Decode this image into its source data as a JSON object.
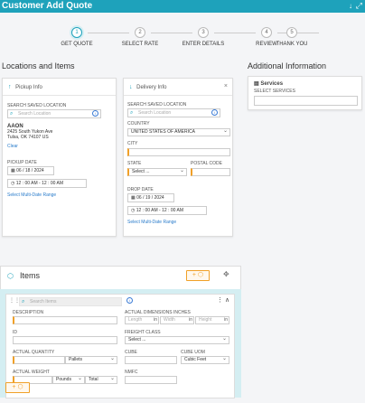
{
  "window": {
    "title": "Customer Add Quote",
    "download_icon": "↓",
    "expand_icon": "⤢"
  },
  "stepper": [
    {
      "num": "1",
      "label": "GET QUOTE"
    },
    {
      "num": "2",
      "label": "SELECT RATE"
    },
    {
      "num": "3",
      "label": "ENTER DETAILS"
    },
    {
      "num": "4",
      "label": "REVIEW"
    },
    {
      "num": "5",
      "label": "THANK YOU"
    }
  ],
  "sections": {
    "locations": "Locations and Items",
    "additional": "Additional Information"
  },
  "pickup": {
    "header": "Pickup Info",
    "search_label": "SEARCH SAVED LOCATION",
    "search_placeholder": "Search Location",
    "company": "AAON",
    "addr1": "2425 South Yukon Ave",
    "addr2": "Tulsa, OK 74107 US",
    "clear": "Clear",
    "date_label": "PICKUP DATE",
    "date": "06 / 18 / 2024",
    "time": "12 : 00   AM  -  12 : 00   AM",
    "multi": "Select Multi-Date Range"
  },
  "delivery": {
    "header": "Delivery Info",
    "search_label": "SEARCH SAVED LOCATION",
    "search_placeholder": "Search Location",
    "country_label": "COUNTRY",
    "country": "UNITED STATES OF AMERICA",
    "city_label": "CITY",
    "state_label": "STATE",
    "state": "Select ...",
    "postal_label": "POSTAL CODE",
    "date_label": "DROP DATE",
    "date": "06 / 19 / 2024",
    "time": "12 : 00   AM  -  12 : 00   AM",
    "multi": "Select Multi-Date Range"
  },
  "services": {
    "title": "Services",
    "label": "SELECT SERVICES"
  },
  "items": {
    "title": "Items",
    "search_placeholder": "Search Items",
    "description_label": "DESCRIPTION",
    "dims_label": "ACTUAL DIMENSIONS INCHES",
    "length": "Length",
    "width": "Width",
    "height": "Height",
    "unit": "in",
    "id_label": "ID",
    "freight_label": "FREIGHT CLASS",
    "freight": "Select ...",
    "qty_label": "ACTUAL QUANTITY",
    "qty_unit": "Pallets",
    "cube_label": "CUBE",
    "cube_uom_label": "CUBE UOM",
    "cube_uom": "Cubic Feet",
    "weight_label": "ACTUAL WEIGHT",
    "weight_unit": "Pounds",
    "weight_type": "Total",
    "nmfc_label": "NMFC"
  },
  "colors": {
    "accent": "#1ea2bb",
    "orange": "#f0a028"
  }
}
